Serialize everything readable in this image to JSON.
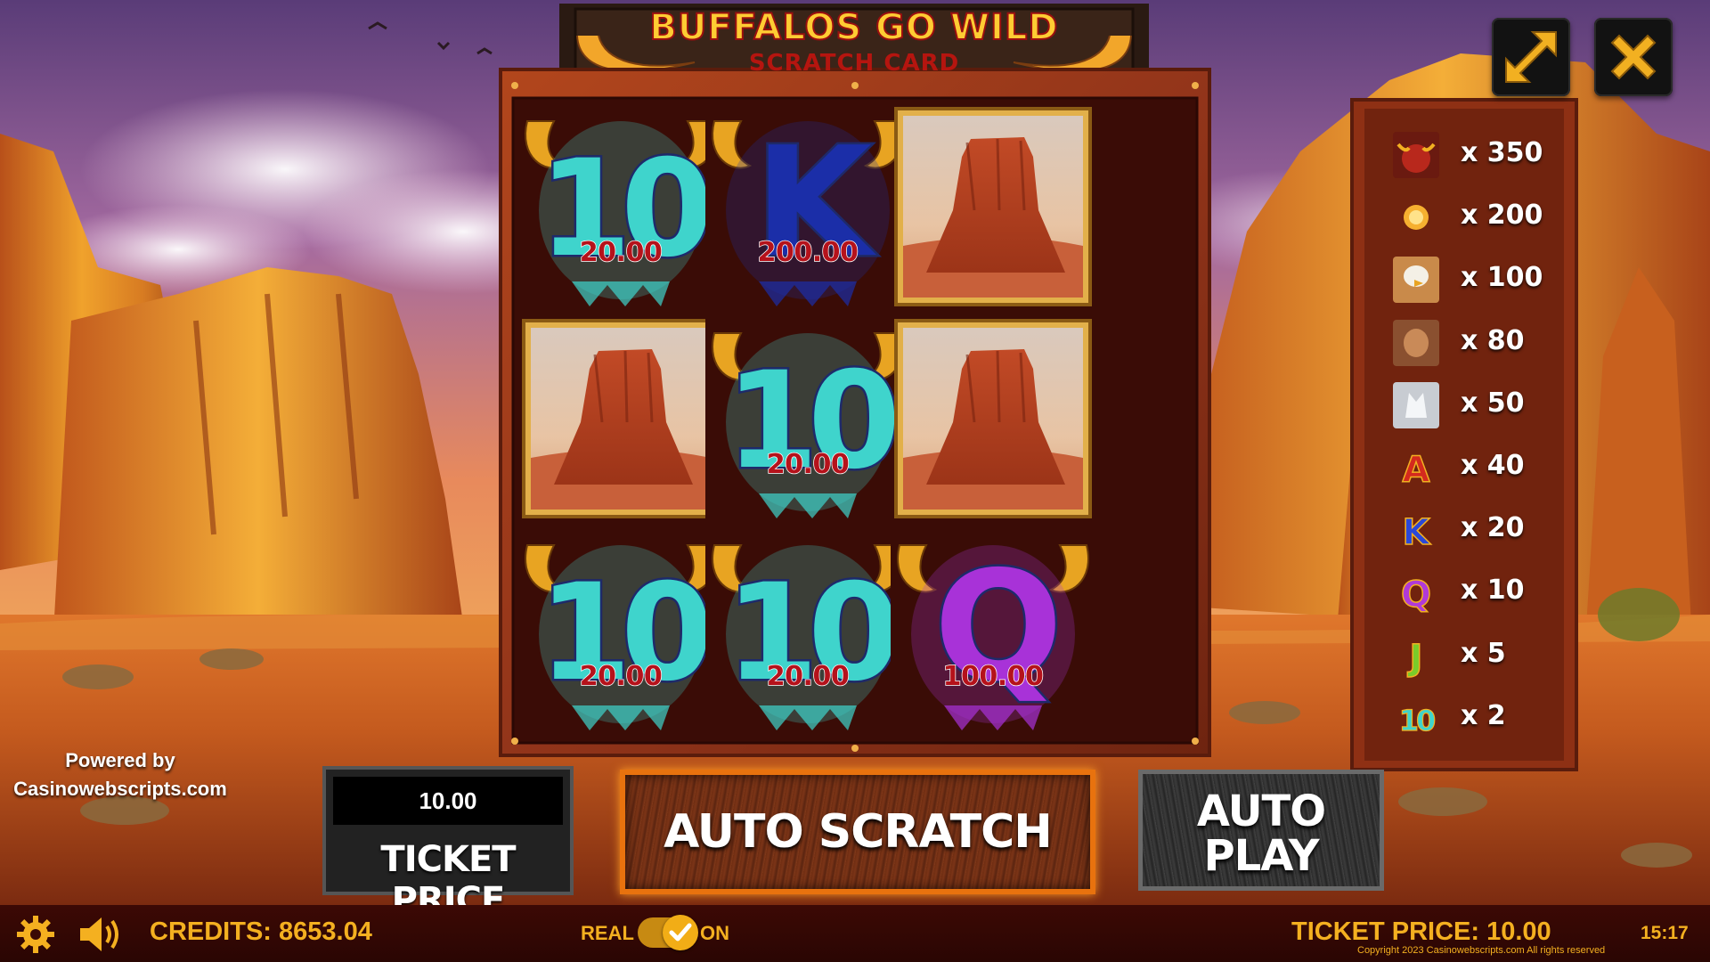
{
  "title": {
    "line1": "BUFFALOS GO WILD",
    "line2": "SCRATCH CARD"
  },
  "top_buttons": {
    "fullscreen_icon": "expand-arrows-icon",
    "close_icon": "close-x-icon"
  },
  "card": {
    "cells": [
      {
        "symbol": "10",
        "value": "20.00",
        "color": "#3fd4cc"
      },
      {
        "symbol": "K",
        "value": "200.00",
        "color": "#1b2ea8"
      },
      {
        "symbol": "mesa",
        "value": ""
      },
      {
        "symbol": "mesa",
        "value": ""
      },
      {
        "symbol": "10",
        "value": "20.00",
        "color": "#3fd4cc"
      },
      {
        "symbol": "mesa",
        "value": ""
      },
      {
        "symbol": "10",
        "value": "20.00",
        "color": "#3fd4cc"
      },
      {
        "symbol": "10",
        "value": "20.00",
        "color": "#3fd4cc"
      },
      {
        "symbol": "Q",
        "value": "100.00",
        "color": "#a832d8"
      }
    ]
  },
  "paytable": [
    {
      "icon": "buffalo-icon",
      "multiplier": "x 350"
    },
    {
      "icon": "sun-coin-icon",
      "multiplier": "x 200"
    },
    {
      "icon": "eagle-icon",
      "multiplier": "x 100"
    },
    {
      "icon": "cougar-icon",
      "multiplier": "x 80"
    },
    {
      "icon": "wolf-icon",
      "multiplier": "x 50"
    },
    {
      "icon": "letter-a-icon",
      "multiplier": "x 40"
    },
    {
      "icon": "letter-k-icon",
      "multiplier": "x 20"
    },
    {
      "icon": "letter-q-icon",
      "multiplier": "x 10"
    },
    {
      "icon": "letter-j-icon",
      "multiplier": "x 5"
    },
    {
      "icon": "number-10-icon",
      "multiplier": "x 2"
    }
  ],
  "powered_by": {
    "line1": "Powered by",
    "line2": "Casinowebscripts.com"
  },
  "controls": {
    "ticket_price_value": "10.00",
    "ticket_price_label": "TICKET PRICE",
    "auto_scratch_label": "AUTO SCRATCH",
    "auto_play_line1": "AUTO",
    "auto_play_line2": "PLAY"
  },
  "status_bar": {
    "credits": "CREDITS: 8653.04",
    "real_label": "REAL",
    "on_label": "ON",
    "real_mode_on": true,
    "ticket_price": "TICKET PRICE: 10.00",
    "clock": "15:17",
    "copyright": "Copyright 2023 Casinowebscripts.com All rights reserved"
  },
  "colors": {
    "status_text": "#f4b020",
    "accent_orange": "#e8720e",
    "value_red": "#b5121b"
  }
}
